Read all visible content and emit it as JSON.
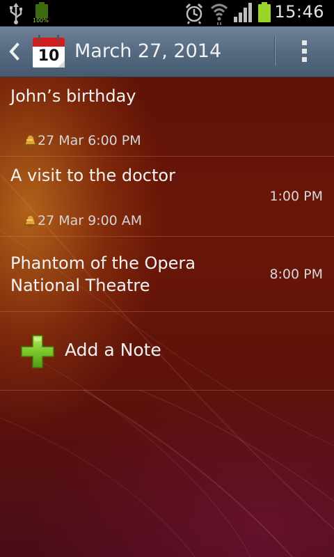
{
  "status_bar": {
    "time": "15:46",
    "battery_percent_label": "100%",
    "icons": [
      "usb-icon",
      "battery-icon",
      "alarm-icon",
      "wifi-icon",
      "signal-icon",
      "battery-full-icon"
    ]
  },
  "action_bar": {
    "title": "March 27, 2014",
    "calendar_day": "10",
    "back_icon": "chevron-left-icon",
    "menu_icon": "overflow-menu-icon"
  },
  "events": [
    {
      "title": "John’s birthday",
      "subtitle": "",
      "time": "",
      "reminder": "27 Mar 6:00 PM"
    },
    {
      "title": "A visit to the doctor",
      "subtitle": "",
      "time": "1:00 PM",
      "reminder": "27 Mar 9:00 AM"
    },
    {
      "title": "Phantom of the Opera",
      "subtitle": "National Theatre",
      "time": "8:00 PM",
      "reminder": ""
    }
  ],
  "add_note": {
    "label": "Add a Note",
    "icon": "plus-icon"
  },
  "colors": {
    "background": "#5e120a",
    "action_bar": "#566b82",
    "plus_green": "#7cc62c",
    "battery_green": "#9ad428"
  }
}
